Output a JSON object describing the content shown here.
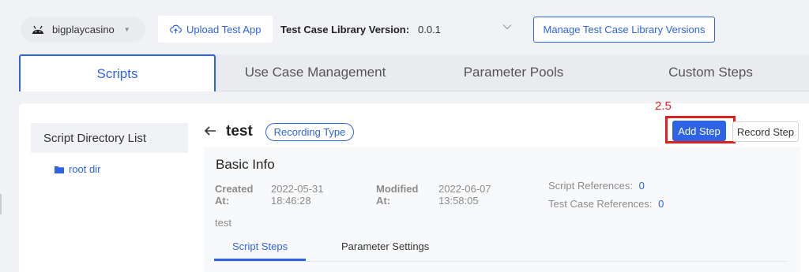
{
  "topbar": {
    "app_name": "bigplaycasino",
    "upload_label": "Upload Test App",
    "version_label": "Test Case Library Version:",
    "version_value": "0.0.1",
    "manage_label": "Manage Test Case Library Versions"
  },
  "tabs": [
    {
      "label": "Scripts",
      "active": true
    },
    {
      "label": "Use Case Management",
      "active": false
    },
    {
      "label": "Parameter Pools",
      "active": false
    },
    {
      "label": "Custom Steps",
      "active": false
    }
  ],
  "sidebar": {
    "header": "Script Directory List",
    "items": [
      {
        "label": "root dir"
      }
    ]
  },
  "script": {
    "title": "test",
    "type_badge": "Recording Type"
  },
  "annotation": {
    "label": "2.5",
    "color": "#e02020"
  },
  "actions": {
    "add_step": "Add Step",
    "record_step": "Record Step"
  },
  "basic_info": {
    "title": "Basic Info",
    "created_label_1": "Created",
    "created_label_2": "At:",
    "created_date": "2022-05-31",
    "created_time": "18:46:28",
    "modified_label_1": "Modified",
    "modified_label_2": "At:",
    "modified_date": "2022-06-07",
    "modified_time": "13:58:05",
    "script_refs_label": "Script References:",
    "script_refs_value": "0",
    "testcase_refs_label": "Test Case References:",
    "testcase_refs_value": "0",
    "description": "test"
  },
  "sub_tabs": [
    {
      "label": "Script Steps",
      "active": true
    },
    {
      "label": "Parameter Settings",
      "active": false
    }
  ],
  "colors": {
    "accent": "#2e63e6",
    "annotation": "#e02020"
  }
}
